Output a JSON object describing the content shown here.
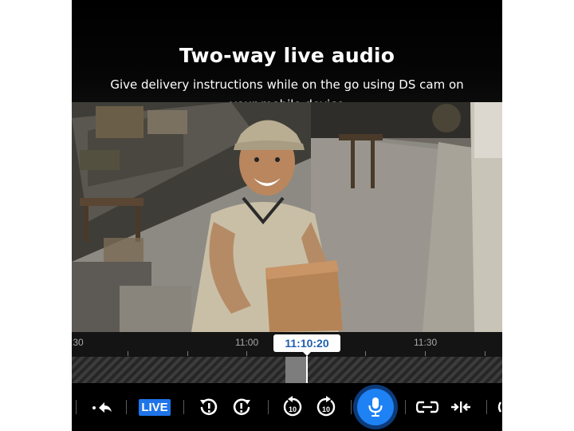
{
  "header": {
    "title": "Two-way live audio",
    "subtitle": "Give delivery instructions while on the go using DS cam on your mobile device"
  },
  "timeline": {
    "tick_labels": [
      ":30",
      "11:00",
      "11:30"
    ],
    "current_time": "11:10:20"
  },
  "controls": {
    "live_label": "LIVE",
    "skip_back_seconds": "10",
    "skip_forward_seconds": "10",
    "icons": [
      "more-icon",
      "share-icon",
      "live-badge",
      "previous-event-icon",
      "next-event-icon",
      "rewind-10-icon",
      "forward-10-icon",
      "microphone-icon",
      "zoom-out-icon",
      "zoom-in-icon"
    ]
  },
  "colors": {
    "accent": "#1e82f5",
    "live_badge": "#1e74e8",
    "time_text": "#1f5fae",
    "background": "#000000"
  }
}
